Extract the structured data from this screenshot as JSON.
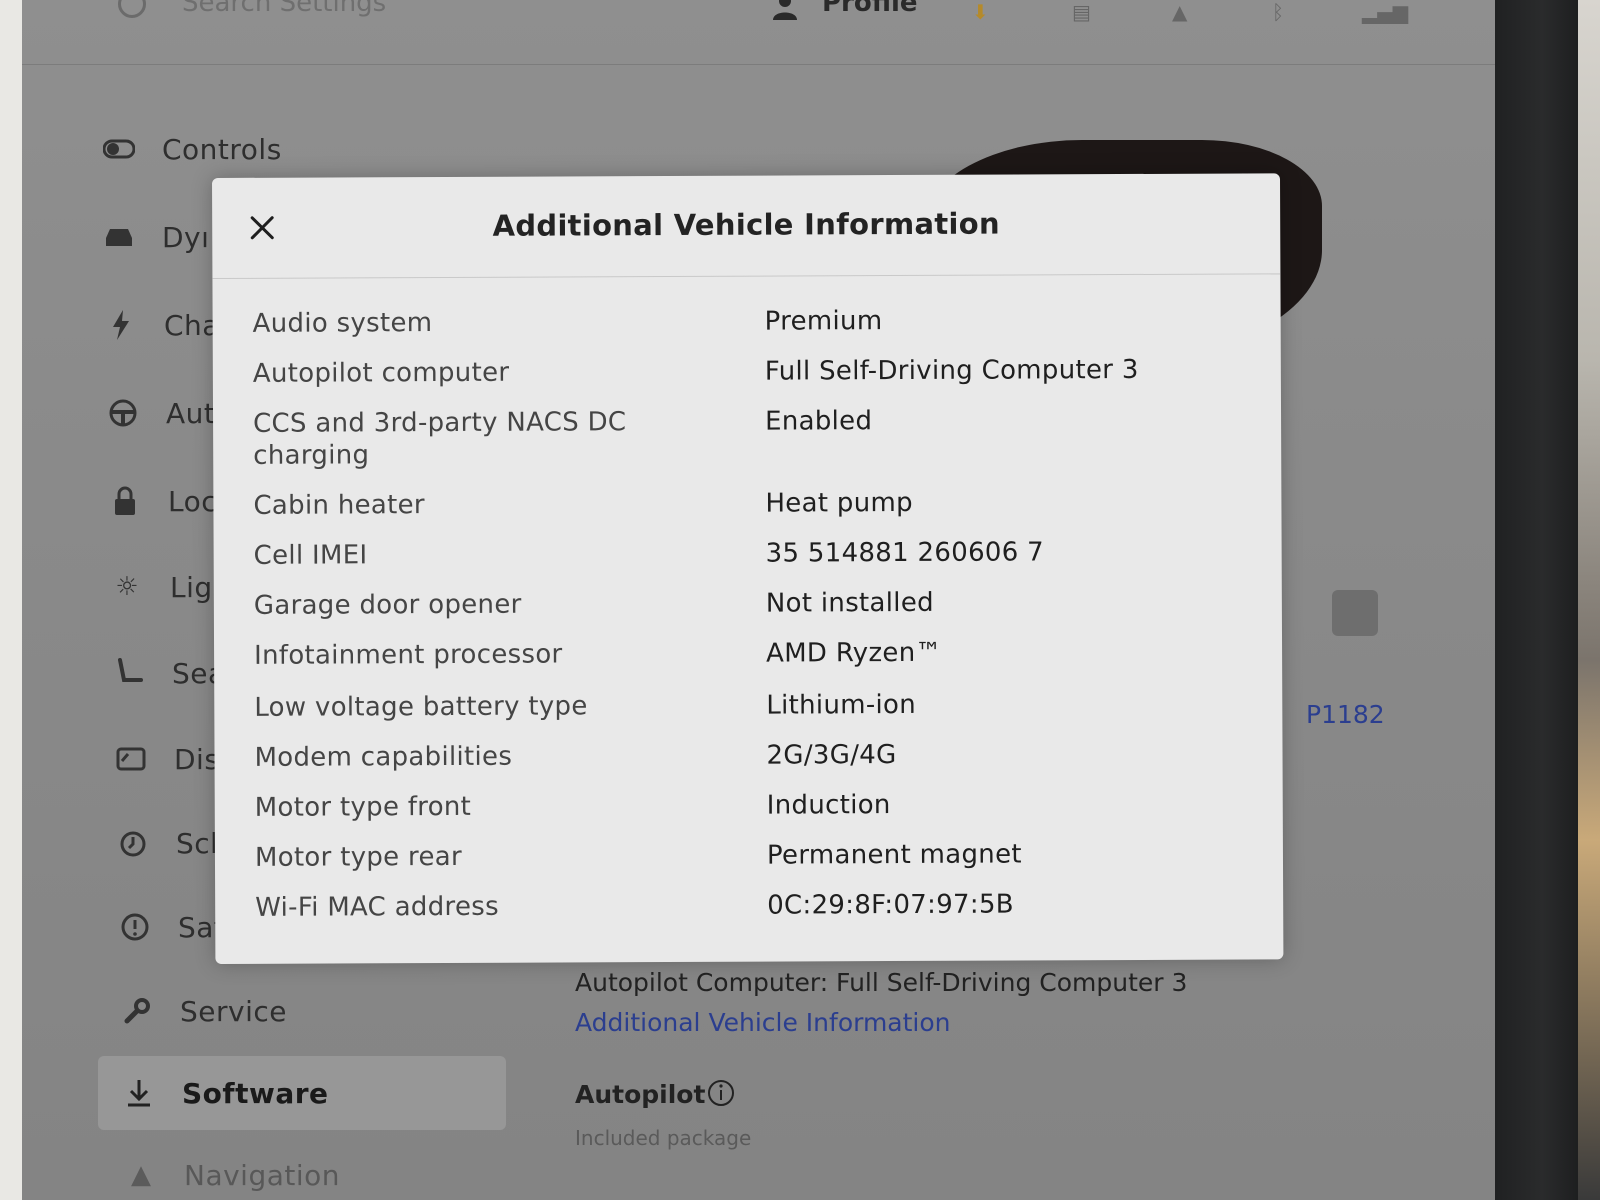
{
  "topbar": {
    "search_placeholder": "Search Settings",
    "profile_label": "Profile"
  },
  "sidebar": {
    "items": [
      {
        "label": "Controls",
        "icon": "toggle-icon"
      },
      {
        "label": "Dyı",
        "icon": "car-icon"
      },
      {
        "label": "Cha",
        "icon": "lightning-icon"
      },
      {
        "label": "Aut",
        "icon": "steering-wheel-icon"
      },
      {
        "label": "Loc",
        "icon": "lock-icon"
      },
      {
        "label": "Ligl",
        "icon": "sun-icon"
      },
      {
        "label": "Sea",
        "icon": "seat-icon"
      },
      {
        "label": "Dis",
        "icon": "display-icon"
      },
      {
        "label": "Sch",
        "icon": "alarm-clock-icon"
      },
      {
        "label": "Saf",
        "icon": "alert-circle-icon"
      },
      {
        "label": "Service",
        "icon": "wrench-icon"
      },
      {
        "label": "Software",
        "icon": "download-icon"
      },
      {
        "label": "Navigation",
        "icon": "navigation-icon"
      }
    ],
    "selected": "Software"
  },
  "background": {
    "right_code": "P1182",
    "autopilot_computer_line": "Autopilot Computer: Full Self-Driving Computer 3",
    "additional_info_link": "Additional Vehicle Information",
    "autopilot_label": "Autopilot",
    "autopilot_sub": "Included package"
  },
  "modal": {
    "title": "Additional Vehicle Information",
    "rows": [
      {
        "key": "Audio system",
        "value": "Premium"
      },
      {
        "key": "Autopilot computer",
        "value": "Full Self-Driving Computer 3"
      },
      {
        "key": "CCS and 3rd-party NACS DC charging",
        "value": "Enabled"
      },
      {
        "key": "Cabin heater",
        "value": "Heat pump"
      },
      {
        "key": "Cell IMEI",
        "value": "35 514881 260606 7"
      },
      {
        "key": "Garage door opener",
        "value": "Not installed"
      },
      {
        "key": "Infotainment processor",
        "value": "AMD Ryzen™"
      },
      {
        "key": "Low voltage battery type",
        "value": "Lithium-ion"
      },
      {
        "key": "Modem capabilities",
        "value": "2G/3G/4G"
      },
      {
        "key": "Motor type front",
        "value": "Induction"
      },
      {
        "key": "Motor type rear",
        "value": "Permanent magnet"
      },
      {
        "key": "Wi-Fi MAC address",
        "value": "0C:29:8F:07:97:5B"
      }
    ]
  }
}
